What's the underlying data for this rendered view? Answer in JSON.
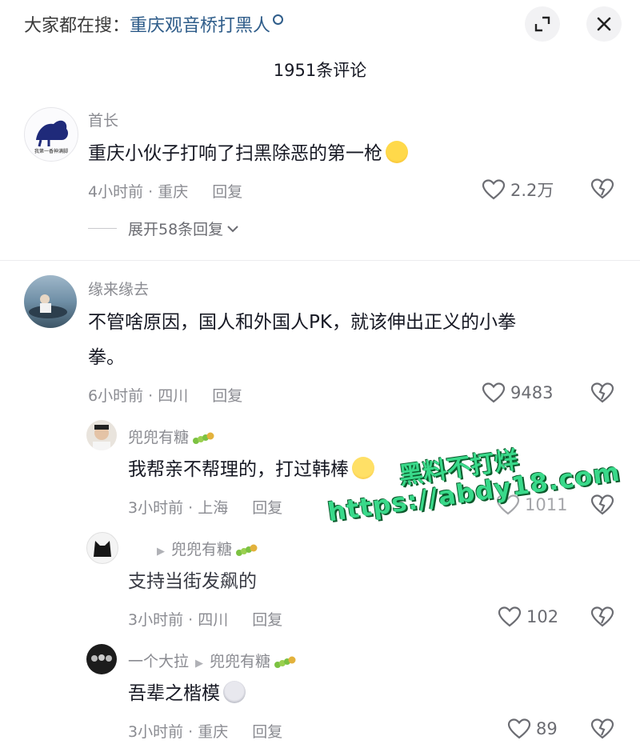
{
  "header": {
    "search_prefix": "大家都在搜：",
    "search_keyword": "重庆观音桥打黑人",
    "comment_count_title": "1951条评论"
  },
  "comments": [
    {
      "username": "首长",
      "avatar_text": "我第一香神满脚",
      "text": "重庆小伙子打响了扫黑除恶的第一枪",
      "meta": "4小时前 · 重庆",
      "reply_label": "回复",
      "likes": "2.2万",
      "expand_label": "展开58条回复"
    },
    {
      "username": "缘来缘去",
      "text_line1": "不管啥原因，国人和外国人PK，就该伸出正义的小拳",
      "text_line2": "拳。",
      "meta": "6小时前 · 四川",
      "reply_label": "回复",
      "likes": "9483",
      "replies": [
        {
          "username": "兜兜有糖",
          "text": "我帮亲不帮理的，打过韩棒",
          "meta": "3小时前 · 上海",
          "reply_label": "回复",
          "likes": "1011"
        },
        {
          "username": "兜兜有糖",
          "text": "支持当街发飙的",
          "meta": "3小时前 · 四川",
          "reply_label": "回复",
          "likes": "102"
        },
        {
          "username": "一个大拉",
          "reply_to": "兜兜有糖",
          "text": "吾辈之楷模",
          "meta": "3小时前 · 重庆",
          "reply_label": "回复",
          "likes": "89"
        }
      ]
    }
  ],
  "watermark": {
    "line1": "黑料不打烊",
    "line2": "https://abdy18.com"
  },
  "colors": {
    "text_primary": "#161823",
    "text_secondary": "#8a8b91",
    "keyword_blue": "#2f5d8a",
    "watermark_green": "#39d98a"
  },
  "icons": [
    "fullscreen-icon",
    "close-icon",
    "heart-icon",
    "dislike-icon",
    "chevron-down-icon",
    "laugh-cry-emoji",
    "caterpillar-icon",
    "grin-emoji",
    "husky-emoji"
  ]
}
